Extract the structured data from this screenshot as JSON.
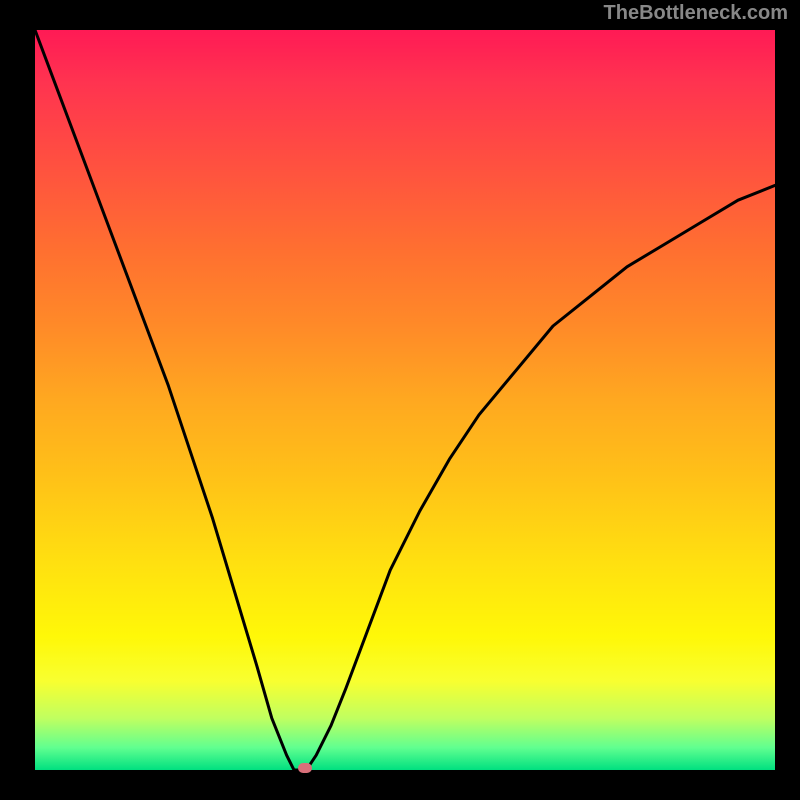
{
  "attribution": "TheBottleneck.com",
  "chart_data": {
    "type": "line",
    "title": "",
    "xlabel": "",
    "ylabel": "",
    "xlim": [
      0,
      100
    ],
    "ylim": [
      0,
      100
    ],
    "background_gradient": {
      "direction": "vertical",
      "stops": [
        {
          "pct": 0,
          "color": "#ff1a55"
        },
        {
          "pct": 50,
          "color": "#ffa820"
        },
        {
          "pct": 82,
          "color": "#fff808"
        },
        {
          "pct": 100,
          "color": "#00e080"
        }
      ]
    },
    "series": [
      {
        "name": "bottleneck-curve",
        "x": [
          0,
          3,
          6,
          9,
          12,
          15,
          18,
          21,
          24,
          27,
          30,
          32,
          34,
          35,
          36,
          37,
          38,
          40,
          42,
          45,
          48,
          52,
          56,
          60,
          65,
          70,
          75,
          80,
          85,
          90,
          95,
          100
        ],
        "values": [
          100,
          92,
          84,
          76,
          68,
          60,
          52,
          43,
          34,
          24,
          14,
          7,
          2,
          0,
          0,
          0.5,
          2,
          6,
          11,
          19,
          27,
          35,
          42,
          48,
          54,
          60,
          64,
          68,
          71,
          74,
          77,
          79
        ]
      }
    ],
    "marker": {
      "x": 36.5,
      "y": 0,
      "color": "#d9707a"
    }
  }
}
